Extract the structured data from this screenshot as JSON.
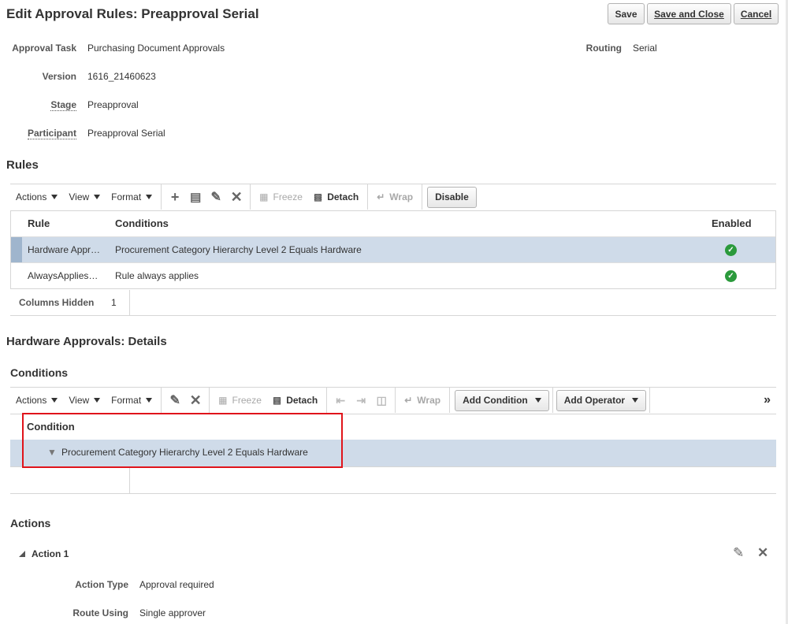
{
  "header": {
    "title": "Edit Approval Rules: Preapproval Serial",
    "save_label": "Save",
    "save_close_label": "Save and Close",
    "cancel_label": "Cancel"
  },
  "info": {
    "approval_task_label": "Approval Task",
    "approval_task_value": "Purchasing Document Approvals",
    "version_label": "Version",
    "version_value": "1616_21460623",
    "stage_label": "Stage",
    "stage_value": "Preapproval",
    "participant_label": "Participant",
    "participant_value": "Preapproval Serial",
    "routing_label": "Routing",
    "routing_value": "Serial"
  },
  "rules": {
    "section_title": "Rules",
    "toolbar": {
      "actions": "Actions",
      "view": "View",
      "format": "Format",
      "freeze": "Freeze",
      "detach": "Detach",
      "wrap": "Wrap",
      "disable": "Disable"
    },
    "columns": {
      "rule": "Rule",
      "conditions": "Conditions",
      "enabled": "Enabled"
    },
    "rows": [
      {
        "rule": "Hardware Appr…",
        "conditions": "Procurement Category Hierarchy Level 2 Equals Hardware",
        "enabled": true
      },
      {
        "rule": "AlwaysApplies…",
        "conditions": "Rule always applies",
        "enabled": true
      }
    ],
    "columns_hidden_label": "Columns Hidden",
    "columns_hidden_value": "1"
  },
  "details": {
    "section_title": "Hardware Approvals: Details",
    "conditions_title": "Conditions",
    "toolbar": {
      "actions": "Actions",
      "view": "View",
      "format": "Format",
      "freeze": "Freeze",
      "detach": "Detach",
      "wrap": "Wrap",
      "add_condition": "Add Condition",
      "add_operator": "Add Operator",
      "more": "»"
    },
    "condition_header": "Condition",
    "condition_row": "Procurement Category Hierarchy Level 2 Equals Hardware",
    "highlight_color": "#e0141b"
  },
  "actions_section": {
    "title": "Actions",
    "action1_label": "Action 1",
    "action_type_label": "Action Type",
    "action_type_value": "Approval required",
    "route_using_label": "Route Using",
    "route_using_value": "Single approver"
  }
}
